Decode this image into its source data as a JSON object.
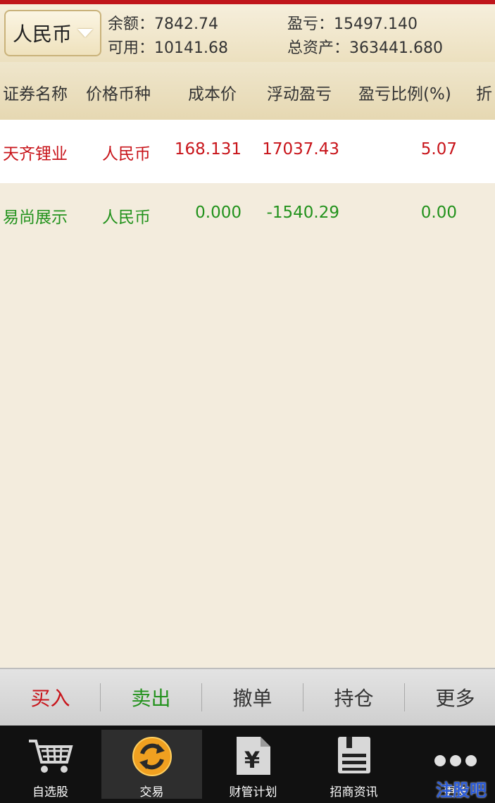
{
  "header": {
    "currency": "人民币",
    "balance": "余额：7842.74",
    "available": "可用：10141.68",
    "profit": "盈亏：15497.140",
    "total_assets": "总资产：363441.680"
  },
  "columns": [
    "证券名称",
    "价格币种",
    "成本价",
    "浮动盈亏",
    "盈亏比例(%)",
    "折"
  ],
  "rows": [
    {
      "name": "天齐锂业",
      "currency": "人民币",
      "cost": "168.131",
      "float_pl": "17037.43",
      "pl_ratio": "5.07",
      "status": "profit"
    },
    {
      "name": "易尚展示",
      "currency": "人民币",
      "cost": "0.000",
      "float_pl": "-1540.29",
      "pl_ratio": "0.00",
      "status": "loss"
    }
  ],
  "actions": {
    "buy": "买入",
    "sell": "卖出",
    "cancel": "撤单",
    "position": "持仓",
    "more": "更多"
  },
  "tabs": [
    {
      "label": "自选股",
      "icon": "cart-icon"
    },
    {
      "label": "交易",
      "icon": "exchange-icon"
    },
    {
      "label": "财管计划",
      "icon": "document-yen-icon"
    },
    {
      "label": "招商资讯",
      "icon": "news-icon"
    },
    {
      "label": "更多",
      "icon": "more-dots-icon"
    }
  ],
  "watermark": "注股吧",
  "colors": {
    "accent": "#c0161b",
    "profit": "#c8141a",
    "loss": "#22921c",
    "background": "#f3ecdd"
  }
}
